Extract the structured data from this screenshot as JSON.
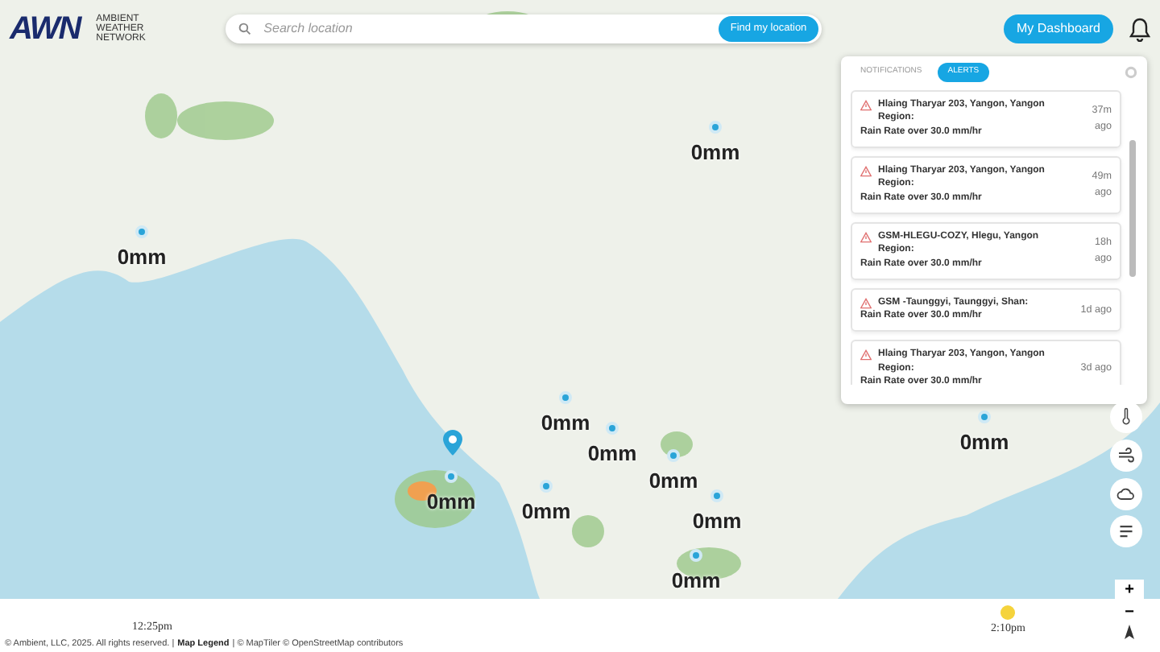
{
  "header": {
    "logo": "AWN",
    "logo_caption": "AMBIENT WEATHER NETWORK",
    "search": {
      "placeholder": "Search location"
    },
    "locate_button": "Find my location",
    "dashboard_button": "My Dashboard"
  },
  "map": {
    "stations": [
      {
        "reading": "0mm"
      },
      {
        "reading": "0mm"
      },
      {
        "reading": "0mm"
      },
      {
        "reading": "0mm"
      },
      {
        "reading": "0mm"
      },
      {
        "reading": "0mm"
      },
      {
        "reading": "0mm"
      },
      {
        "reading": "0mm"
      },
      {
        "reading": "0mm"
      },
      {
        "reading": "0mm"
      }
    ]
  },
  "alerts_panel": {
    "tabs": [
      {
        "label": "NOTIFICATIONS",
        "selected": false
      },
      {
        "label": "ALERTS",
        "selected": true
      }
    ],
    "alerts": [
      {
        "location": "Hlaing Tharyar 203, Yangon, Yangon Region:",
        "message": "Rain Rate over 30.0 mm/hr",
        "time": "37m ago"
      },
      {
        "location": "Hlaing Tharyar 203, Yangon, Yangon Region:",
        "message": "Rain Rate over 30.0 mm/hr",
        "time": "49m ago"
      },
      {
        "location": "GSM-HLEGU-COZY, Hlegu, Yangon Region:",
        "message": "Rain Rate over 30.0 mm/hr",
        "time": "18h ago"
      },
      {
        "location": "GSM -Taunggyi, Taunggyi, Shan:",
        "message": "Rain Rate over 30.0 mm/hr",
        "time": "1d ago"
      },
      {
        "location": "Hlaing Tharyar 203, Yangon, Yangon Region:",
        "message": "Rain Rate over 30.0 mm/hr",
        "time": "3d ago"
      }
    ]
  },
  "timeline": {
    "start": "12:25pm",
    "end": "2:10pm"
  },
  "footer": {
    "copyright": "© Ambient, LLC, 2025. All rights reserved. |",
    "legend_link": "Map Legend",
    "credits": "| © MapTiler © OpenStreetMap contributors"
  },
  "zoom_controls": {
    "zoom_in": "+",
    "zoom_out": "−"
  }
}
